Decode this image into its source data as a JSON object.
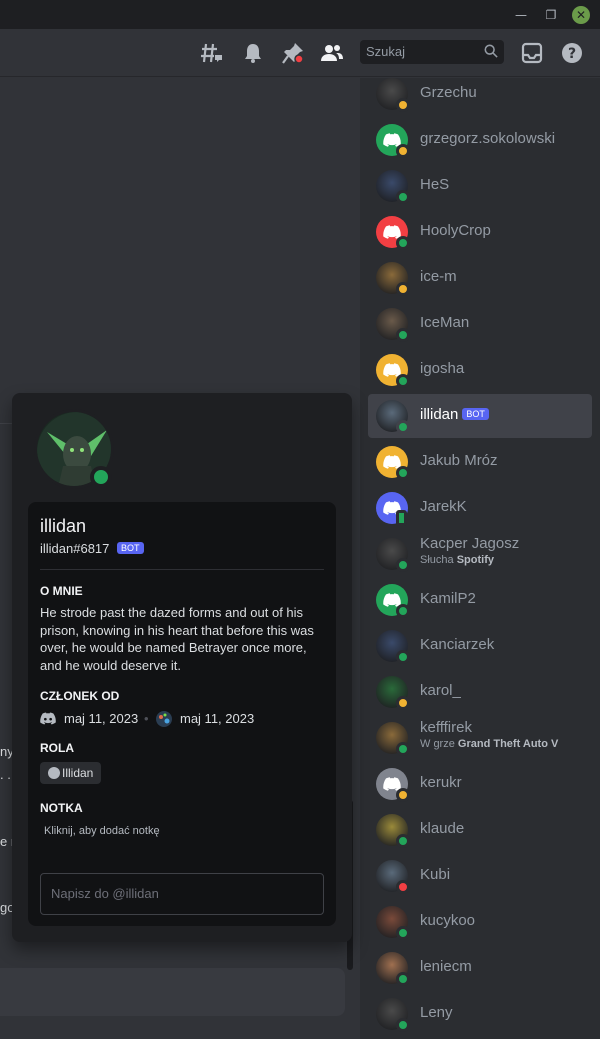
{
  "header": {
    "search_placeholder": "Szukaj",
    "icons": [
      "threads-icon",
      "bell-icon",
      "pin-icon",
      "members-icon",
      "search-icon",
      "inbox-icon",
      "help-icon"
    ]
  },
  "colors": {
    "online": "#23a55a",
    "idle": "#f0b232",
    "dnd": "#f23f43",
    "blurple": "#5865f2"
  },
  "chat": {
    "fragments": [
      "ny",
      ". .",
      "e r",
      "go"
    ]
  },
  "popout": {
    "display_name": "illidan",
    "username": "illidan#6817",
    "bot_badge": "BOT",
    "about_heading": "O MNIE",
    "about_text": "He strode past the dazed forms and out of his prison, knowing in his heart that before this was over, he would be named Betrayer once more, and he would deserve it.",
    "member_since_heading": "CZŁONEK OD",
    "discord_date": "maj 11, 2023",
    "server_date": "maj 11, 2023",
    "role_heading": "ROLA",
    "role": "Illidan",
    "note_heading": "NOTKA",
    "note_placeholder": "Kliknij, aby dodać notkę",
    "message_placeholder": "Napisz do @illidan"
  },
  "members": [
    {
      "name": "Grzechu",
      "status": "idle",
      "avatar": "photo"
    },
    {
      "name": "grzegorz.sokolowski",
      "status": "idle",
      "avatar": "discord-green"
    },
    {
      "name": "HeS",
      "status": "online",
      "avatar": "photo"
    },
    {
      "name": "HoolyCrop",
      "status": "online",
      "avatar": "discord-red"
    },
    {
      "name": "ice-m",
      "status": "idle",
      "avatar": "photo"
    },
    {
      "name": "IceMan",
      "status": "online",
      "avatar": "photo"
    },
    {
      "name": "igosha",
      "status": "online",
      "avatar": "discord-orange"
    },
    {
      "name": "illidan",
      "status": "online",
      "avatar": "photo",
      "bot": "BOT",
      "selected": true
    },
    {
      "name": "Jakub Mróz",
      "status": "online",
      "avatar": "discord-orange"
    },
    {
      "name": "JarekK",
      "status": "mobile",
      "avatar": "discord-blurple"
    },
    {
      "name": "Kacper Jagosz",
      "status": "online",
      "avatar": "photo",
      "sub_prefix": "Słucha",
      "sub_bold": "Spotify"
    },
    {
      "name": "KamilP2",
      "status": "online",
      "avatar": "discord-green"
    },
    {
      "name": "Kanciarzek",
      "status": "online",
      "avatar": "photo"
    },
    {
      "name": "karol_",
      "status": "idle",
      "avatar": "photo"
    },
    {
      "name": "kefffirek",
      "status": "online",
      "avatar": "photo",
      "sub_prefix": "W grze",
      "sub_bold": "Grand Theft Auto V"
    },
    {
      "name": "kerukr",
      "status": "idle",
      "avatar": "discord-grey"
    },
    {
      "name": "klaude",
      "status": "online",
      "avatar": "photo"
    },
    {
      "name": "Kubi",
      "status": "dnd",
      "avatar": "photo"
    },
    {
      "name": "kucykoo",
      "status": "online",
      "avatar": "photo"
    },
    {
      "name": "leniecm",
      "status": "online",
      "avatar": "photo"
    },
    {
      "name": "Leny",
      "status": "online",
      "avatar": "photo"
    }
  ]
}
